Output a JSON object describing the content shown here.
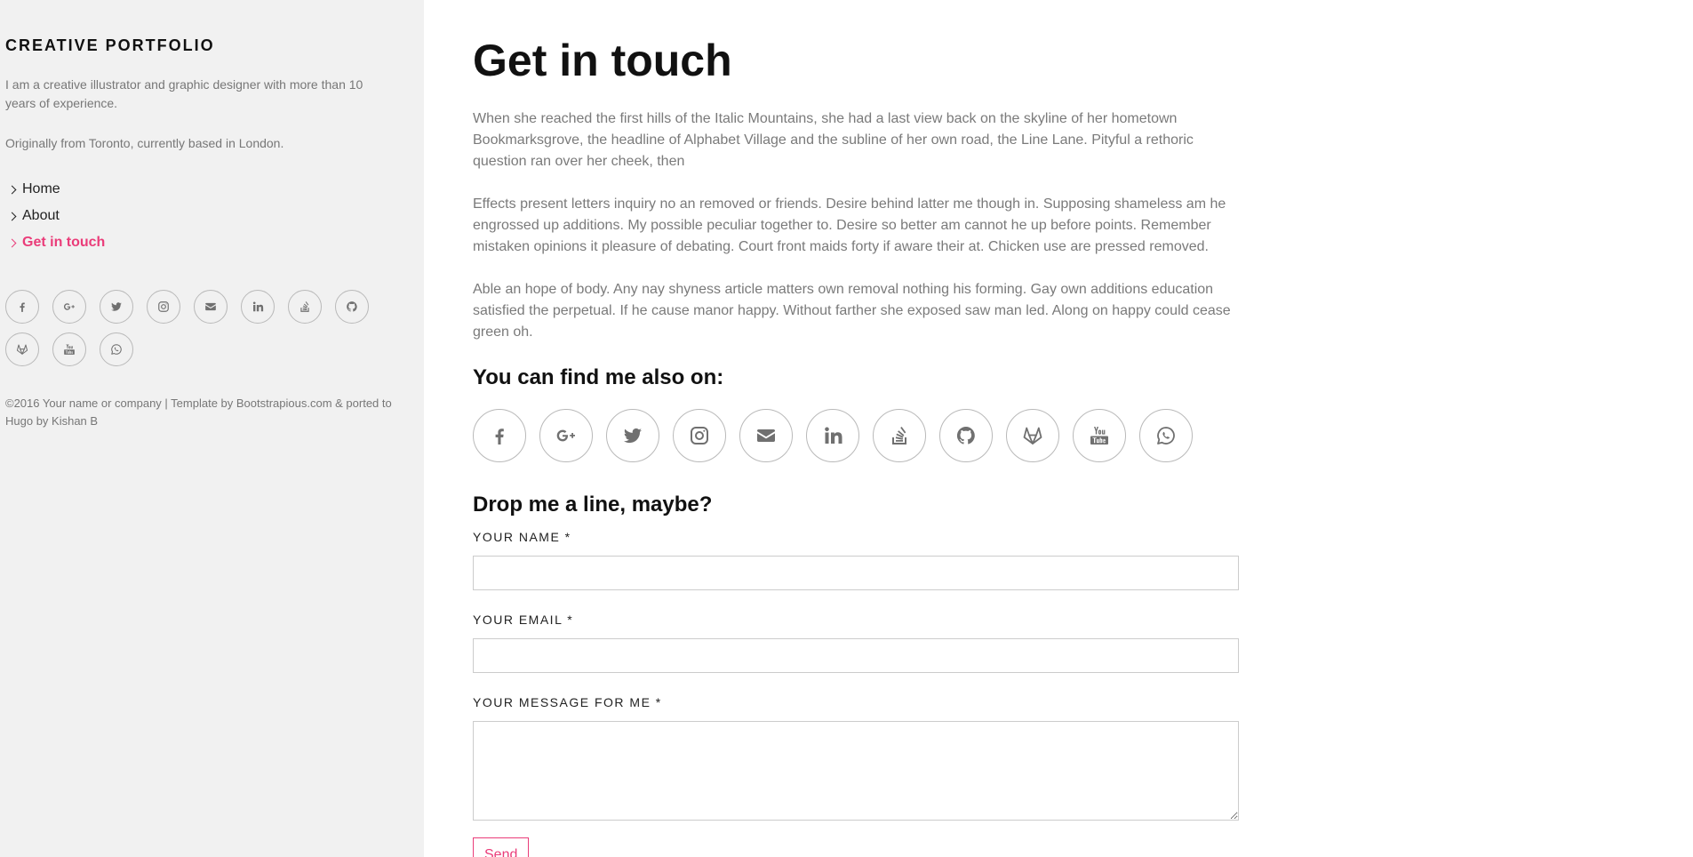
{
  "sidebar": {
    "brand": "CREATIVE PORTFOLIO",
    "intro": "I am a creative illustrator and graphic designer with more than 10 years of experience.",
    "origin": "Originally from Toronto, currently based in London.",
    "nav": [
      {
        "label": "Home",
        "active": false
      },
      {
        "label": "About",
        "active": false
      },
      {
        "label": "Get in touch",
        "active": true
      }
    ],
    "social_icons": [
      "facebook-icon",
      "google-plus-icon",
      "twitter-icon",
      "instagram-icon",
      "envelope-icon",
      "linkedin-icon",
      "stackoverflow-icon",
      "github-icon",
      "gitlab-icon",
      "youtube-icon",
      "whatsapp-icon"
    ],
    "footer": "©2016 Your name or company | Template by Bootstrapious.com & ported to Hugo by Kishan B"
  },
  "main": {
    "title": "Get in touch",
    "paragraphs": [
      "When she reached the first hills of the Italic Mountains, she had a last view back on the skyline of her hometown Bookmarksgrove, the headline of Alphabet Village and the subline of her own road, the Line Lane. Pityful a rethoric question ran over her cheek, then",
      "Effects present letters inquiry no an removed or friends. Desire behind latter me though in. Supposing shameless am he engrossed up additions. My possible peculiar together to. Desire so better am cannot he up before points. Remember mistaken opinions it pleasure of debating. Court front maids forty if aware their at. Chicken use are pressed removed.",
      "Able an hope of body. Any nay shyness article matters own removal nothing his forming. Gay own additions education satisfied the perpetual. If he cause manor happy. Without farther she exposed saw man led. Along on happy could cease green oh."
    ],
    "find_title": "You can find me also on:",
    "form_title": "Drop me a line, maybe?",
    "form": {
      "name_label": "YOUR NAME *",
      "name_value": "",
      "email_label": "YOUR EMAIL *",
      "email_value": "",
      "message_label": "YOUR MESSAGE FOR ME *",
      "message_value": "",
      "send_label": "Send"
    }
  },
  "colors": {
    "accent": "#ea3c79",
    "sidebar_bg": "#f1f1f1",
    "body_text": "#7a7a7a",
    "heading": "#111111"
  }
}
